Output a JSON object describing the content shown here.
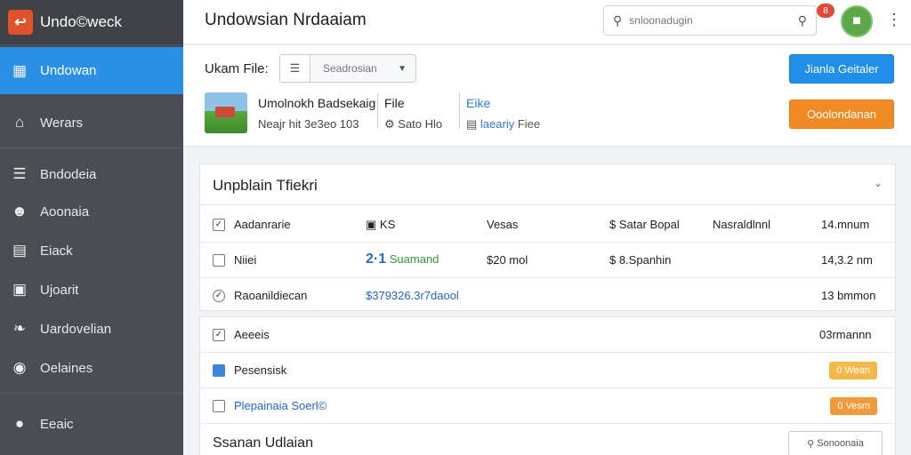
{
  "brand": {
    "logo_icon": "back-arrow-icon",
    "name": "Undo©weck"
  },
  "sidebar": {
    "items": [
      {
        "label": "Undowan",
        "icon": "grid-icon",
        "glyph": "▦"
      },
      {
        "label": "Werars",
        "icon": "home-icon",
        "glyph": "⌂"
      },
      {
        "label": "Bndodeia",
        "icon": "list-icon",
        "glyph": "☰"
      },
      {
        "label": "Aoonaia",
        "icon": "user-icon",
        "glyph": "☻"
      },
      {
        "label": "Eiack",
        "icon": "card-icon",
        "glyph": "▤"
      },
      {
        "label": "Ujoarit",
        "icon": "tag-icon",
        "glyph": "▣"
      },
      {
        "label": "Uardovelian",
        "icon": "bird-icon",
        "glyph": "❧"
      },
      {
        "label": "Oelaines",
        "icon": "circle-icon",
        "glyph": "◉"
      },
      {
        "label": "Eeaic",
        "icon": "chat-icon",
        "glyph": "●"
      }
    ]
  },
  "header": {
    "title": "Undowsian Nrdaaiam",
    "search_placeholder": "snloonadugin",
    "notification_count": "8",
    "accent": "#2b8fe6"
  },
  "file": {
    "label": "Ukam File:",
    "select_value": "Seadrosian",
    "name": "Umolnokh Badsekaig",
    "meta": "Neajr hit 3e3eo 103",
    "type_header": "File",
    "type_value": "Sato Hlo",
    "link_header": "Eike",
    "link_value": "laeariy",
    "link_suffix": "Fiee",
    "primary_button": "Jianla Geitaler",
    "secondary_button": "Ooolondanan"
  },
  "table": {
    "title": "Unpblain Tfiekri",
    "rows": [
      {
        "check": "✓",
        "name": "Aadanrarie",
        "col2": "KS",
        "col3": "Vesas",
        "col4": "$ Satar Bopal",
        "col5": "Nasraldlnnl",
        "col6": "14.mnum"
      },
      {
        "check": "",
        "name": "Niiei",
        "col2_num": "2·1",
        "col2_text": "Suamand",
        "col3": "$20 mol",
        "col4": "$ 8.Spanhin",
        "col6": "14,3.2 nm"
      },
      {
        "check": "✓",
        "name": "Raoanildiecan",
        "col2": "$379326.3r7daool",
        "col6": "13 bmmon"
      }
    ]
  },
  "list": {
    "rows": [
      {
        "check": "✓",
        "name": "Aeeeis",
        "value": "03rmannn"
      },
      {
        "check": "",
        "name": "Pesensisk",
        "badge": "0 Wean"
      },
      {
        "check": "",
        "name": "Plepainaia Soerl©",
        "badge": "0 Vesm"
      }
    ],
    "footer_title": "Ssanan Udlaian",
    "filter_button": "Sonoonaia"
  },
  "colors": {
    "primary": "#1f8fea",
    "orange": "#f08a24",
    "sidebar": "#4a4d52"
  }
}
